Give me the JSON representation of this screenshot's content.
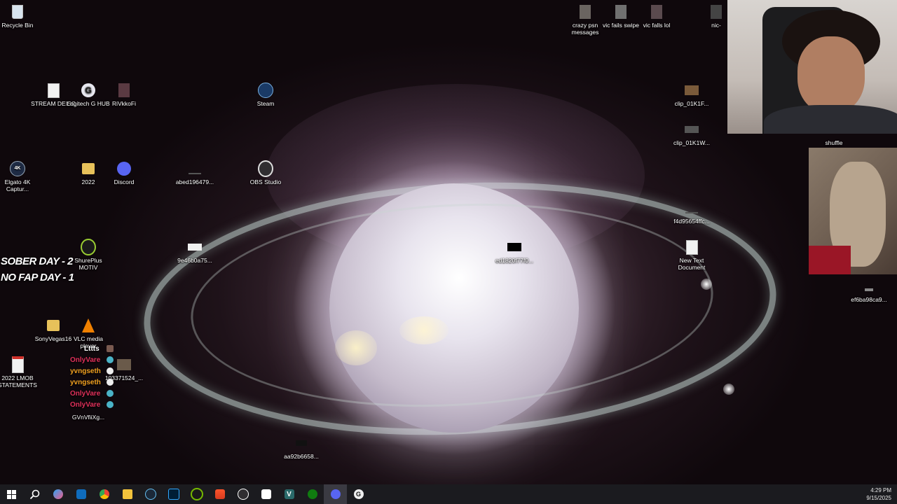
{
  "desktop_icons": {
    "recycle_bin": "Recycle Bin",
    "stream_deisc": "STREAM DEISC",
    "logitech": "Logitech G HUB",
    "rivkkofi": "RiVkkoFi",
    "steam": "Steam",
    "elgato": "Elgato 4K Captur...",
    "folder_2022": "2022",
    "discord": "Discord",
    "abed": "abed196479...",
    "obs": "OBS Studio",
    "shureplus": "ShurePlus MOTIV",
    "file_9e46": "9e46b0a75...",
    "file_ed18": "ed1820f77f0...",
    "sonyvegas": "SonyVegas16",
    "vlc": "VLC media player",
    "lmob": "2022 LMOB STATEMENTS",
    "file_1033": "103371524_...",
    "gvnv": "GVnVfiiXg...",
    "file_aa92": "aa92b6658...",
    "crazy_psn": "crazy psn messages",
    "vic_swipe": "vic fails swipe",
    "vic_lol": "vic falls lol",
    "nic": "nic-",
    "clip1": "clip_01K1F...",
    "clip2": "clip_01K1W...",
    "shuffle": "shuffle",
    "f4d9": "f4d95654ffc...",
    "new_text": "New Text Document",
    "ef6b": "ef6ba98ca9..."
  },
  "stream_overlay": {
    "sober": "SOBER DAY - 2",
    "nofap": "NO FAP DAY - 1"
  },
  "chat": [
    {
      "name": "Lttts",
      "color": "#ffffff"
    },
    {
      "name": "OnlyVare",
      "color": "#e0305a"
    },
    {
      "name": "yvngseth",
      "color": "#f0a020"
    },
    {
      "name": "yvngseth",
      "color": "#f0a020"
    },
    {
      "name": "OnlyVare",
      "color": "#e0305a"
    },
    {
      "name": "OnlyVare",
      "color": "#e0305a"
    }
  ],
  "taskbar": {
    "time": "4:29 PM",
    "date": "9/15/2025",
    "apps": [
      "start-icon",
      "search-icon",
      "copilot-icon",
      "outlook-icon",
      "chrome-icon",
      "file-explorer-icon",
      "steam-icon",
      "photoshop-icon",
      "nvidia-icon",
      "brave-icon",
      "obs-icon",
      "store-icon",
      "vegas-icon",
      "xbox-icon",
      "discord-icon",
      "logitech-icon"
    ]
  },
  "colors": {
    "taskbar_bg": "#1b1b1f",
    "overlay_text": "#ffffff"
  }
}
